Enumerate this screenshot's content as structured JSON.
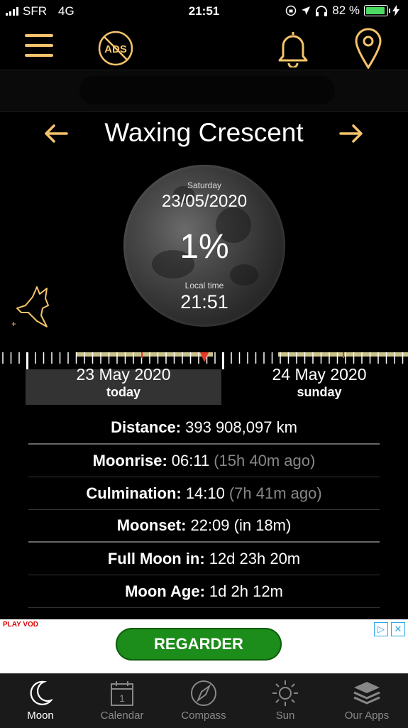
{
  "status_bar": {
    "carrier": "SFR",
    "network": "4G",
    "time": "21:51",
    "battery": "82 %",
    "battery_level": 0.82
  },
  "toolbar": {
    "menu_icon": "hamburger-icon",
    "ads_icon": "no-ads-icon",
    "ads_label": "ADS",
    "bell_icon": "bell-icon",
    "location_icon": "location-pin-icon"
  },
  "phase": {
    "title": "Waxing Crescent",
    "prev_icon": "arrow-left-icon",
    "next_icon": "arrow-right-icon"
  },
  "moon": {
    "day": "Saturday",
    "date": "23/05/2020",
    "illumination": "1%",
    "local_time_label": "Local time",
    "local_time": "21:51"
  },
  "timeline": {
    "day1": {
      "date": "23 May 2020",
      "label": "today"
    },
    "day2": {
      "date": "24 May 2020",
      "label": "sunday"
    }
  },
  "info": [
    {
      "label": "Distance:",
      "value": "393 908,097 km",
      "extra": ""
    },
    {
      "label": "Moonrise:",
      "value": "06:11",
      "extra": "(15h 40m ago)"
    },
    {
      "label": "Culmination:",
      "value": "14:10",
      "extra": "(7h 41m ago)"
    },
    {
      "label": "Moonset:",
      "value": "22:09 (in 18m)",
      "extra": ""
    },
    {
      "label": "Full Moon in:",
      "value": "12d 23h 20m",
      "extra": ""
    },
    {
      "label": "Moon Age:",
      "value": "1d 2h 12m",
      "extra": ""
    }
  ],
  "ad": {
    "brand": "PLAY VOD",
    "button": "REGARDER"
  },
  "tabs": [
    {
      "label": "Moon",
      "icon": "moon-icon",
      "active": true
    },
    {
      "label": "Calendar",
      "icon": "calendar-icon",
      "active": false
    },
    {
      "label": "Compass",
      "icon": "compass-icon",
      "active": false
    },
    {
      "label": "Sun",
      "icon": "sun-icon",
      "active": false
    },
    {
      "label": "Our Apps",
      "icon": "layers-icon",
      "active": false
    }
  ],
  "colors": {
    "accent": "#f5c36b",
    "background": "#000000",
    "ad_button": "#1c8c1a",
    "tab_bar": "#1a1a1a"
  }
}
